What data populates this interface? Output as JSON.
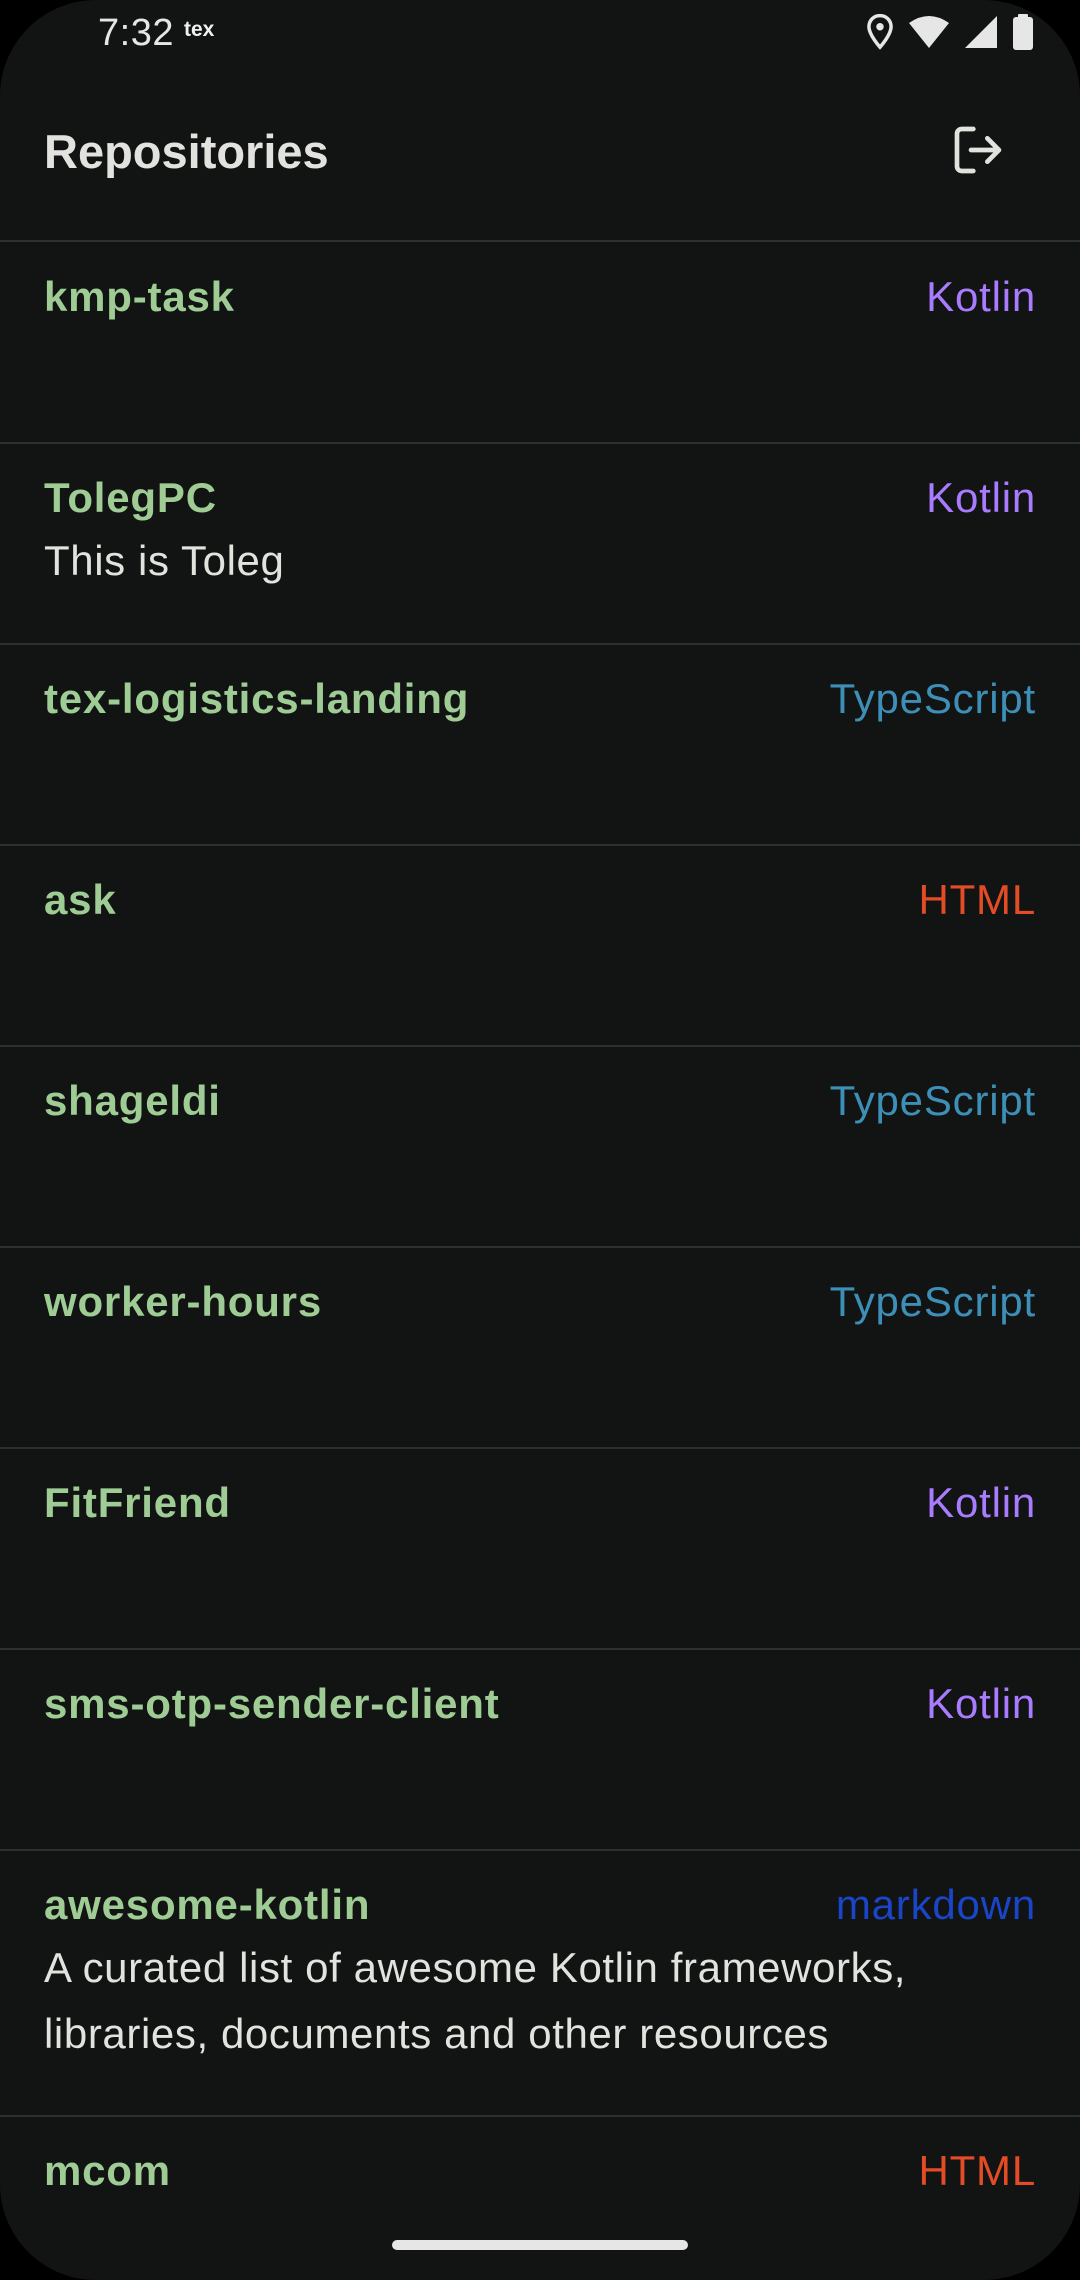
{
  "status_bar": {
    "time": "7:32",
    "carrier": "tex",
    "icons": [
      "location-icon",
      "wifi-icon",
      "signal-icon",
      "battery-icon"
    ]
  },
  "app_bar": {
    "title": "Repositories",
    "logout_icon": "logout-icon"
  },
  "colors": {
    "Kotlin": "#a97bff",
    "TypeScript": "#3d8fb8",
    "HTML": "#e34c26",
    "markdown": "#1a45c9",
    "repo_name": "#9fcc95",
    "background": "#111412"
  },
  "repos": [
    {
      "name": "kmp-task",
      "language": "Kotlin",
      "description": ""
    },
    {
      "name": "TolegPC",
      "language": "Kotlin",
      "description": "This is Toleg"
    },
    {
      "name": "tex-logistics-landing",
      "language": "TypeScript",
      "description": ""
    },
    {
      "name": "ask",
      "language": "HTML",
      "description": ""
    },
    {
      "name": "shageldi",
      "language": "TypeScript",
      "description": ""
    },
    {
      "name": "worker-hours",
      "language": "TypeScript",
      "description": ""
    },
    {
      "name": "FitFriend",
      "language": "Kotlin",
      "description": ""
    },
    {
      "name": "sms-otp-sender-client",
      "language": "Kotlin",
      "description": ""
    },
    {
      "name": "awesome-kotlin",
      "language": "markdown",
      "description": "A curated list of awesome Kotlin frameworks, libraries, documents and other resources"
    },
    {
      "name": "mcom",
      "language": "HTML",
      "description": ""
    }
  ]
}
